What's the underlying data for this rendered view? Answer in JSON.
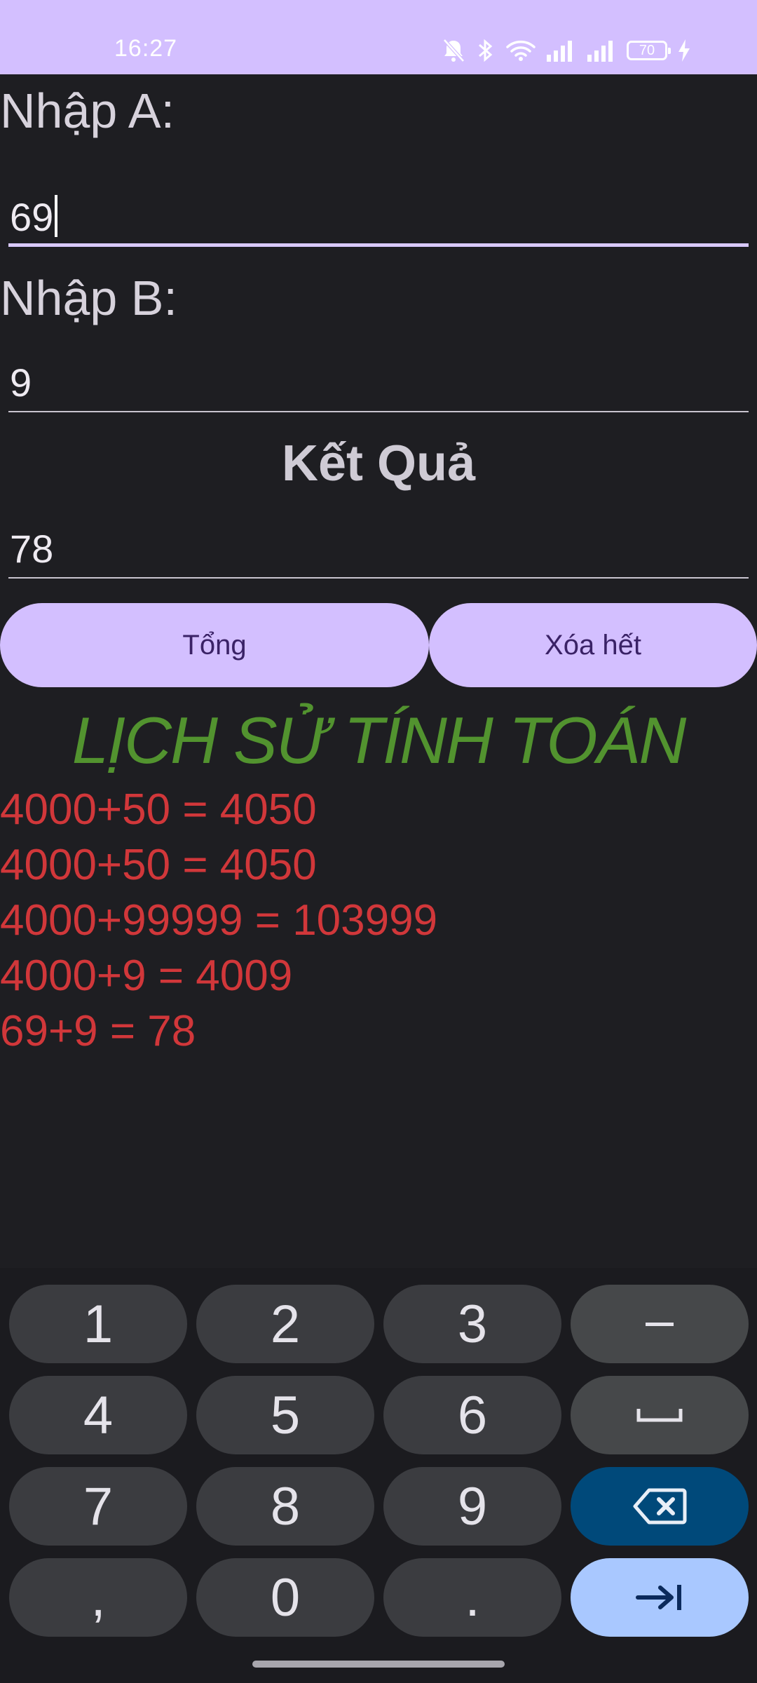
{
  "status_bar": {
    "time": "16:27",
    "battery": "70",
    "icons": [
      "mute-icon",
      "bluetooth-icon",
      "wifi-icon",
      "signal-icon",
      "signal-icon",
      "battery-icon",
      "charging-icon"
    ]
  },
  "form": {
    "label_a": "Nhập A:",
    "value_a": "69",
    "label_b": "Nhập B:",
    "value_b": "9",
    "result_title": "Kết Quả",
    "result_value": "78"
  },
  "buttons": {
    "sum": "Tổng",
    "clear": "Xóa hết"
  },
  "history": {
    "title": "LỊCH SỬ TÍNH TOÁN",
    "items": [
      "4000+50 = 4050",
      "4000+50 = 4050",
      "4000+99999 = 103999",
      "4000+9 = 4009",
      "69+9 = 78"
    ]
  },
  "keyboard": {
    "keys": [
      "1",
      "2",
      "3",
      "−",
      "4",
      "5",
      "6",
      "␣",
      "7",
      "8",
      "9",
      "⌫",
      ",",
      "0",
      ".",
      "⇥"
    ]
  },
  "colors": {
    "accent": "#d3bfff",
    "history_title": "#52932f",
    "history_items": "#d1373a",
    "background": "#1e1e22"
  }
}
